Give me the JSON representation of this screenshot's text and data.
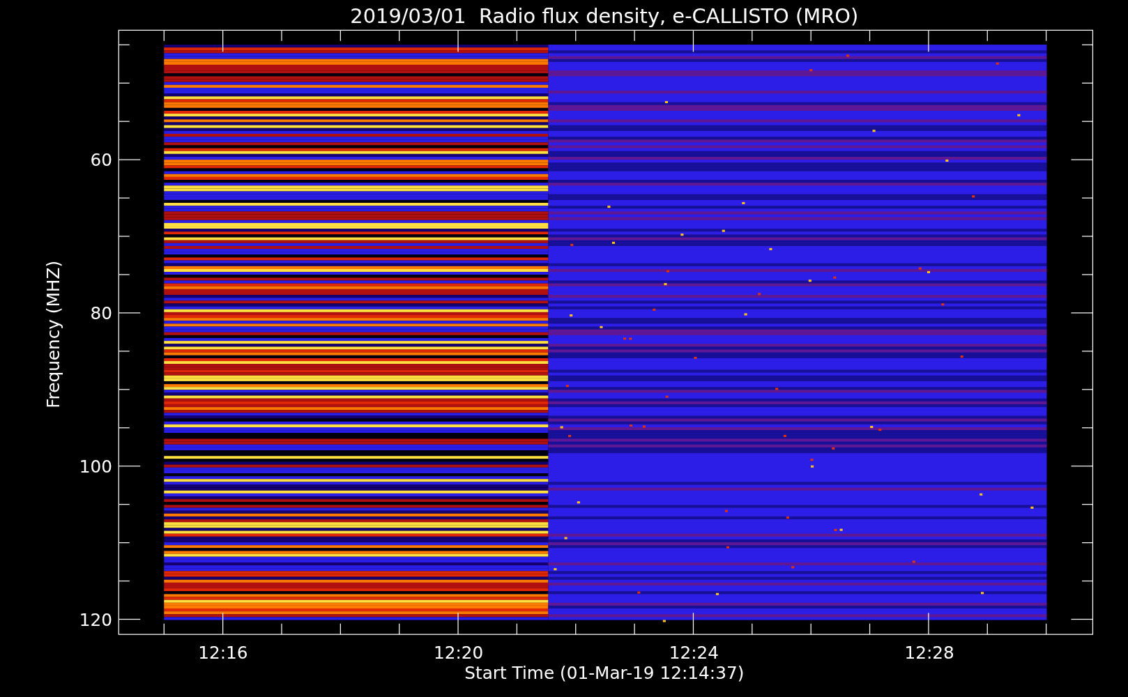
{
  "title": "2019/03/01  Radio flux density, e-CALLISTO (MRO)",
  "ylabel": "Frequency (MHZ)",
  "xlabel": "Start Time (01-Mar-19 12:14:37)",
  "yticks": [
    "60",
    "80",
    "100",
    "120"
  ],
  "xticks": [
    "12:16",
    "12:20",
    "12:24",
    "12:28"
  ]
}
